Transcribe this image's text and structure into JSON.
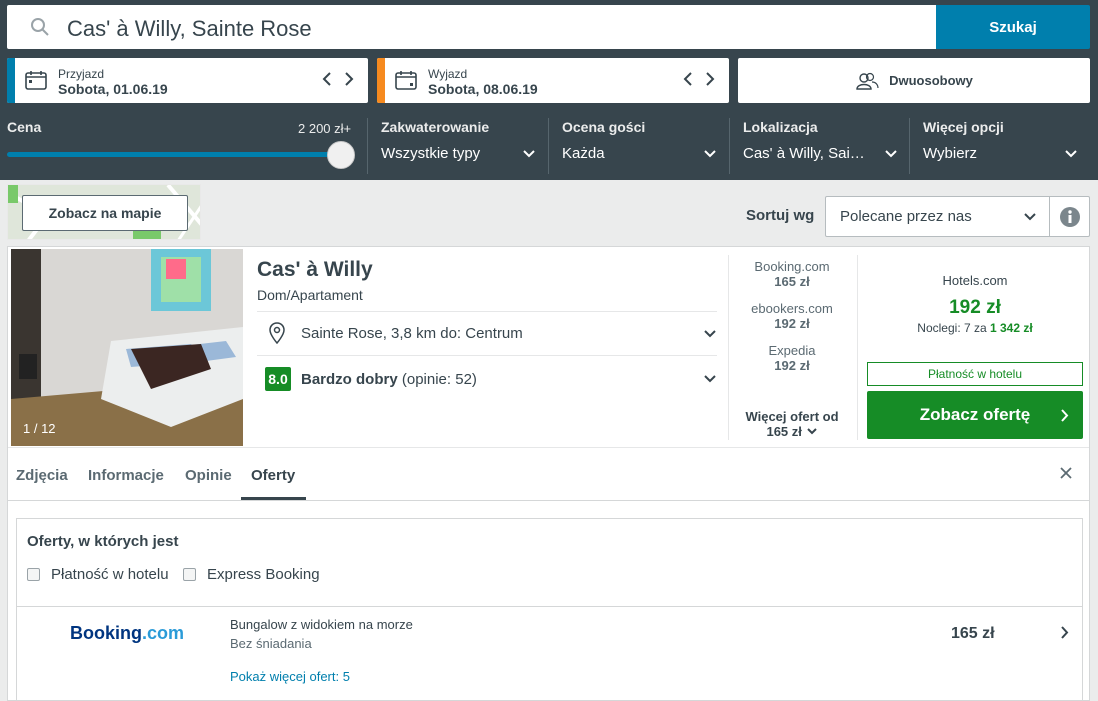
{
  "search": {
    "value": "Cas' à Willy, Sainte Rose",
    "button": "Szukaj"
  },
  "checkin": {
    "label": "Przyjazd",
    "value": "Sobota, 01.06.19",
    "color": "#007fad"
  },
  "checkout": {
    "label": "Wyjazd",
    "value": "Sobota, 08.06.19",
    "color": "#f68a1f"
  },
  "rooms": {
    "label": "Dwuosobowy"
  },
  "filters": {
    "price": {
      "title": "Cena",
      "max": "2 200 zł+",
      "level": 1.0
    },
    "accommodation": {
      "title": "Zakwaterowanie",
      "value": "Wszystkie typy"
    },
    "rating": {
      "title": "Ocena gości",
      "value": "Każda"
    },
    "location": {
      "title": "Lokalizacja",
      "value": "Cas' à Willy, Sai…"
    },
    "more": {
      "title": "Więcej opcji",
      "value": "Wybierz"
    }
  },
  "toolbar": {
    "map_button": "Zobacz na mapie",
    "sort_label": "Sortuj wg",
    "sort_value": "Polecane przez nas"
  },
  "hotel": {
    "photo_counter": "1 / 12",
    "name": "Cas' à Willy",
    "type": "Dom/Apartament",
    "location": "Sainte Rose, 3,8 km do: Centrum",
    "rating_score": "8.0",
    "rating_label": "Bardzo dobry",
    "rating_count": "(opinie: 52)"
  },
  "providers": [
    {
      "name": "Booking.com",
      "price": "165 zł"
    },
    {
      "name": "ebookers.com",
      "price": "192 zł"
    },
    {
      "name": "Expedia",
      "price": "192 zł"
    }
  ],
  "more_offers": {
    "line1": "Więcej ofert od",
    "line2": "165 zł"
  },
  "deal": {
    "provider": "Hotels.com",
    "price": "192 zł",
    "nights_text": "Noclegi: 7 za ",
    "nights_total": "1 342 zł",
    "pay_at_hotel": "Płatność w hotelu",
    "cta": "Zobacz ofertę"
  },
  "tabs": [
    {
      "label": "Zdjęcia"
    },
    {
      "label": "Informacje"
    },
    {
      "label": "Opinie"
    },
    {
      "label": "Oferty"
    }
  ],
  "offers_panel": {
    "title": "Oferty, w których jest",
    "checkboxes": [
      {
        "label": "Płatność w hotelu",
        "checked": false
      },
      {
        "label": "Express Booking",
        "checked": false
      }
    ],
    "offer": {
      "logo_part1": "Booking",
      "logo_part2": ".com",
      "name": "Bungalow z widokiem na morze",
      "meal": "Bez śniadania",
      "more": "Pokaż więcej ofert: 5",
      "price": "165 zł"
    }
  }
}
